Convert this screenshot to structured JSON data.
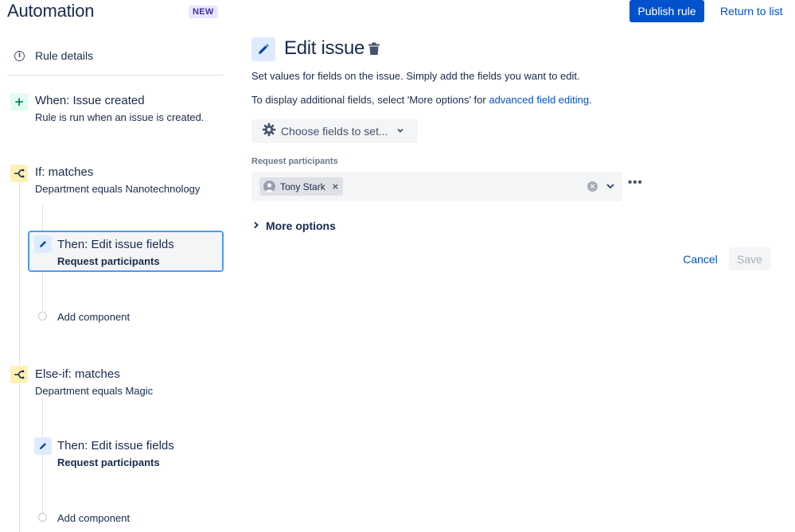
{
  "header": {
    "title": "Automation",
    "badge": "NEW",
    "publish_label": "Publish rule",
    "return_label": "Return to list"
  },
  "sidebar": {
    "rule_details": "Rule details",
    "trigger": {
      "title": "When: Issue created",
      "subtitle": "Rule is run when an issue is created."
    },
    "condition1": {
      "title": "If: matches",
      "subtitle": "Department equals Nanotechnology"
    },
    "action1": {
      "title": "Then: Edit issue fields",
      "subtitle": "Request participants",
      "selected": true
    },
    "add1": "Add component",
    "condition2": {
      "title": "Else-if: matches",
      "subtitle": "Department equals Magic"
    },
    "action2": {
      "title": "Then: Edit issue fields",
      "subtitle": "Request participants"
    },
    "add2": "Add component"
  },
  "main": {
    "title": "Edit issue",
    "description": "Set values for fields on the issue. Simply add the fields you want to edit.",
    "desc2_prefix": "To display additional fields, select 'More options' for ",
    "desc2_link": "advanced field editing",
    "desc2_suffix": ".",
    "choose_fields_label": "Choose fields to set...",
    "field": {
      "label": "Request participants",
      "chips": [
        "Tony Stark"
      ]
    },
    "more_options_label": "More options",
    "cancel_label": "Cancel",
    "save_label": "Save"
  },
  "colors": {
    "primary": "#0052cc",
    "text": "#172b4d",
    "selected_border": "#4c9aff",
    "trigger_bg": "#e3fcef",
    "condition_bg": "#fff0b3",
    "action_bg": "#deebff"
  }
}
